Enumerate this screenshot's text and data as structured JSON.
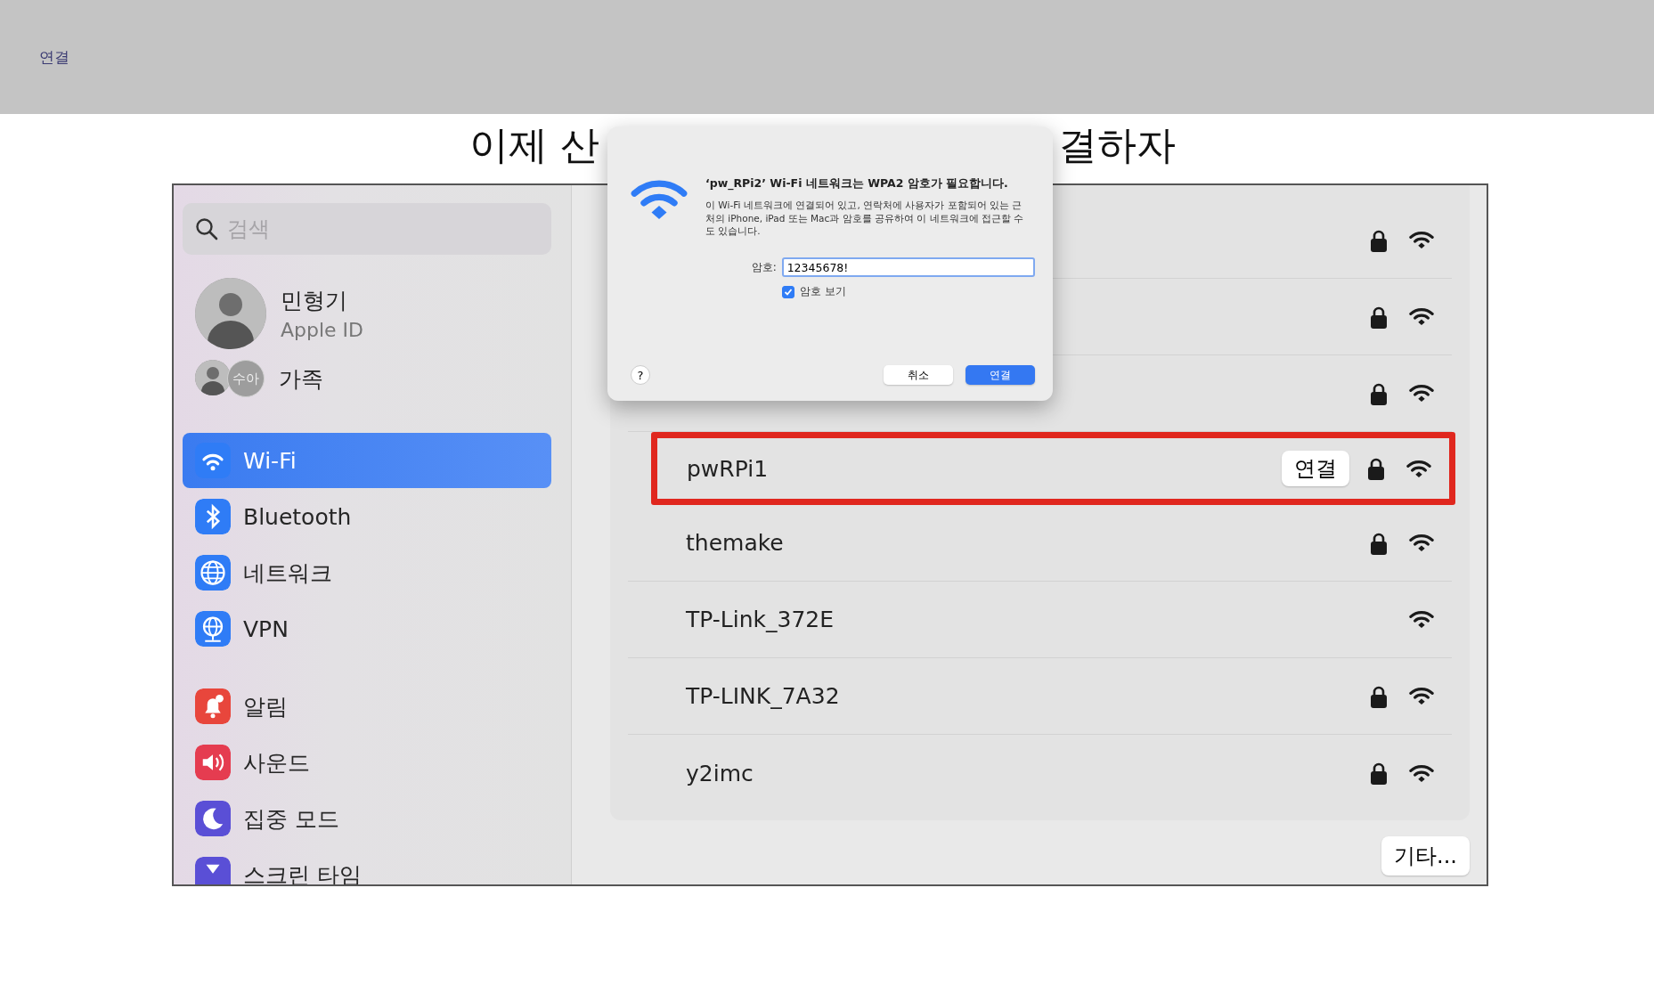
{
  "top_bar": {
    "link": "연결"
  },
  "slide_title": {
    "left": "이제 산",
    "right": "결하자"
  },
  "sidebar": {
    "search": {
      "placeholder": "검색"
    },
    "profile": {
      "name": "민형기",
      "subtitle": "Apple ID"
    },
    "family": {
      "badge": "수아",
      "label": "가족"
    },
    "items": [
      {
        "label": "Wi-Fi",
        "kind": "wifi",
        "color": "#2f7cf6",
        "selected": true
      },
      {
        "label": "Bluetooth",
        "kind": "bluetooth",
        "color": "#2f7cf6",
        "selected": false
      },
      {
        "label": "네트워크",
        "kind": "globe",
        "color": "#2f7cf6",
        "selected": false
      },
      {
        "label": "VPN",
        "kind": "vpn",
        "color": "#2f7cf6",
        "selected": false
      },
      {
        "label": "알림",
        "kind": "bell",
        "color": "#e8463c",
        "selected": false
      },
      {
        "label": "사운드",
        "kind": "sound",
        "color": "#e53c50",
        "selected": false
      },
      {
        "label": "집중 모드",
        "kind": "moon",
        "color": "#5a4fd6",
        "selected": false
      },
      {
        "label": "스크린 타임",
        "kind": "hourglass",
        "color": "#5a4fd6",
        "selected": false
      }
    ]
  },
  "networks": [
    {
      "locked": true,
      "highlighted": false
    },
    {
      "locked": true,
      "highlighted": false
    },
    {
      "locked": true,
      "highlighted": false
    },
    {
      "name": "pwRPi1",
      "locked": true,
      "highlighted": true,
      "button": "연결"
    },
    {
      "name": "themake",
      "locked": true,
      "highlighted": false
    },
    {
      "name": "TP-Link_372E",
      "locked": false,
      "highlighted": false
    },
    {
      "name": "TP-LINK_7A32",
      "locked": true,
      "highlighted": false
    },
    {
      "name": "y2imc",
      "locked": true,
      "highlighted": false
    }
  ],
  "other_button": "기타...",
  "dialog": {
    "title": "‘pw_RPi2’ Wi-Fi 네트워크는 WPA2 암호가 필요합니다.",
    "message": "이 Wi-Fi 네트워크에 연결되어 있고, 연락처에 사용자가 포함되어 있는 근처의 iPhone, iPad 또는 Mac과 암호를 공유하여 이 네트워크에 접근할 수도 있습니다.",
    "password_label": "암호:",
    "password_value": "12345678!",
    "show_password": {
      "label": "암호 보기",
      "checked": true
    },
    "help": "?",
    "cancel": "취소",
    "connect": "연결"
  }
}
